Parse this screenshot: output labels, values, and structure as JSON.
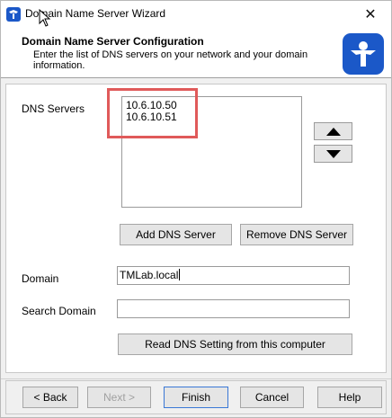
{
  "window": {
    "title": "Domain Name Server Wizard",
    "close_glyph": "✕"
  },
  "header": {
    "title": "Domain Name Server Configuration",
    "subtitle": "Enter the list of DNS servers on your network and your domain information.",
    "logo_icon": "thinmanager-logo-icon"
  },
  "dns": {
    "label": "DNS Servers",
    "servers": [
      "10.6.10.50",
      "10.6.10.51"
    ],
    "move_up_icon": "triangle-up-icon",
    "move_down_icon": "triangle-down-icon",
    "add_label": "Add DNS Server",
    "remove_label": "Remove DNS Server"
  },
  "domain": {
    "label": "Domain",
    "value": "TMLab.local"
  },
  "search_domain": {
    "label": "Search Domain",
    "value": ""
  },
  "read_button": "Read DNS Setting from this computer",
  "footer": {
    "back": "< Back",
    "next": "Next >",
    "finish": "Finish",
    "cancel": "Cancel",
    "help": "Help"
  },
  "colors": {
    "highlight": "#e05a5a",
    "logo": "#1b58c8",
    "primary_border": "#3a78d6"
  }
}
